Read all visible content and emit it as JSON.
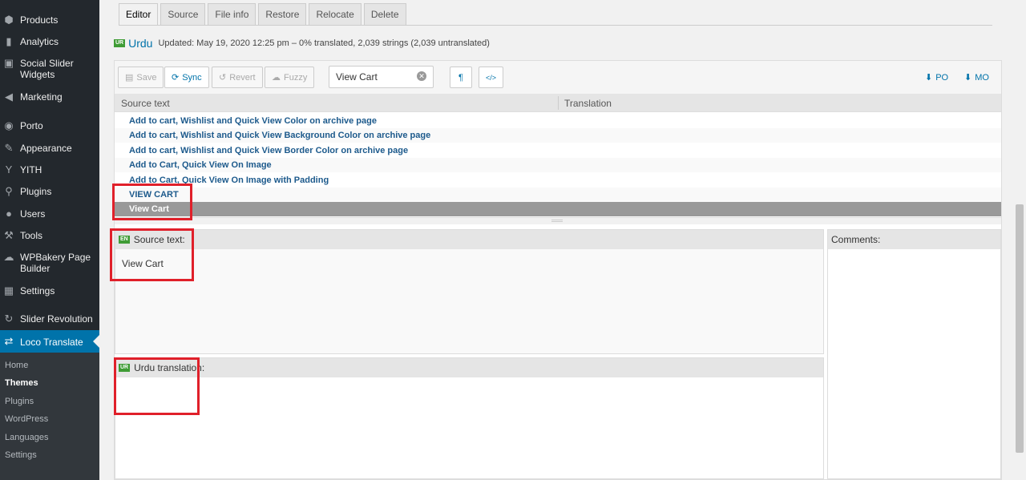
{
  "sidebar": {
    "items": [
      {
        "label": "Products",
        "icon": "products-icon"
      },
      {
        "label": "Analytics",
        "icon": "analytics-icon"
      },
      {
        "label": "Social Slider Widgets",
        "icon": "social-slider-icon"
      },
      {
        "label": "Marketing",
        "icon": "megaphone-icon"
      },
      {
        "label": "Porto",
        "icon": "porto-icon"
      },
      {
        "label": "Appearance",
        "icon": "brush-icon"
      },
      {
        "label": "YITH",
        "icon": "yith-icon"
      },
      {
        "label": "Plugins",
        "icon": "plugin-icon"
      },
      {
        "label": "Users",
        "icon": "users-icon"
      },
      {
        "label": "Tools",
        "icon": "wrench-icon"
      },
      {
        "label": "WPBakery Page Builder",
        "icon": "wpbakery-icon"
      },
      {
        "label": "Settings",
        "icon": "settings-icon"
      },
      {
        "label": "Slider Revolution",
        "icon": "slider-revolution-icon"
      },
      {
        "label": "Loco Translate",
        "icon": "loco-translate-icon"
      }
    ],
    "submenu": [
      "Home",
      "Themes",
      "Plugins",
      "WordPress",
      "Languages",
      "Settings"
    ],
    "current_submenu": "Themes"
  },
  "tabs": [
    "Editor",
    "Source",
    "File info",
    "Restore",
    "Relocate",
    "Delete"
  ],
  "active_tab": "Editor",
  "language": {
    "code": "UR",
    "name": "Urdu",
    "status": "Updated: May 19, 2020 12:25 pm – 0% translated, 2,039 strings (2,039 untranslated)"
  },
  "toolbar": {
    "save": "Save",
    "sync": "Sync",
    "revert": "Revert",
    "fuzzy": "Fuzzy",
    "search_value": "View Cart",
    "pilcrow": "¶",
    "code": "</>",
    "po": "PO",
    "mo": "MO"
  },
  "list": {
    "col_source": "Source text",
    "col_translation": "Translation",
    "rows": [
      "Add to cart, Wishlist and Quick View Color on archive page",
      "Add to cart, Wishlist and Quick View Background Color on archive page",
      "Add to cart, Wishlist and Quick View Border Color on archive page",
      "Add to Cart, Quick View On Image",
      "Add to Cart, Quick View On Image with Padding",
      "VIEW CART",
      "View Cart"
    ]
  },
  "source_pane": {
    "flag": "EN",
    "label": "Source text:",
    "text": "View Cart"
  },
  "translation_pane": {
    "flag": "UR",
    "label": "Urdu translation:"
  },
  "comments_pane": {
    "label": "Comments:"
  },
  "colors": {
    "sidebar_bg": "#23282d",
    "accent": "#0073aa",
    "highlight": "#e0202a",
    "selected_row": "#999999"
  }
}
